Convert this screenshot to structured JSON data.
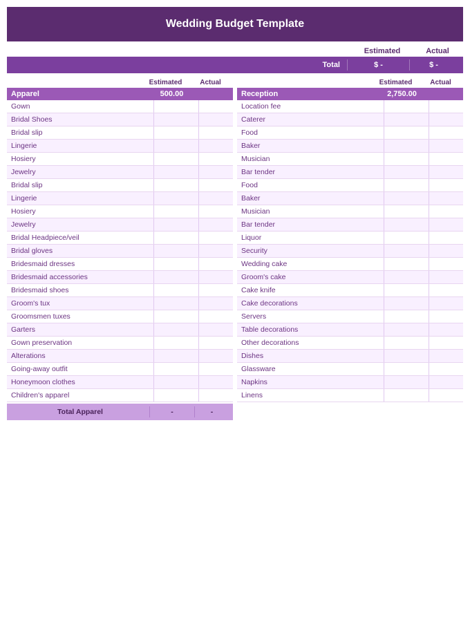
{
  "header": {
    "title": "Wedding Budget Template"
  },
  "summary": {
    "estimated_label": "Estimated",
    "actual_label": "Actual",
    "total_label": "Total",
    "estimated_value": "$ -",
    "actual_value": "$ -"
  },
  "left_column": {
    "col_estimated": "Estimated",
    "col_actual": "Actual",
    "category": "Apparel",
    "category_estimated": "500.00",
    "items": [
      "Gown",
      "Bridal Shoes",
      "Bridal slip",
      "Lingerie",
      "Hosiery",
      "Jewelry",
      "Bridal slip",
      "Lingerie",
      "Hosiery",
      "Jewelry",
      "Bridal Headpiece/veil",
      "Bridal gloves",
      "Bridesmaid dresses",
      "Bridesmaid accessories",
      "Bridesmaid shoes",
      "Groom's tux",
      "Groomsmen tuxes",
      "Garters",
      "Gown preservation",
      "Alterations",
      "Going-away outfit",
      "Honeymoon clothes",
      "Children's apparel"
    ],
    "total_label": "Total Apparel",
    "total_est": "-",
    "total_act": "-"
  },
  "right_column": {
    "col_estimated": "Estimated",
    "col_actual": "Actual",
    "category": "Reception",
    "category_estimated": "2,750.00",
    "items": [
      "Location fee",
      "Caterer",
      "Food",
      "Baker",
      "Musician",
      "Bar tender",
      "Food",
      "Baker",
      "Musician",
      "Bar tender",
      "Liquor",
      "Security",
      "Wedding cake",
      "Groom's cake",
      "Cake knife",
      "Cake decorations",
      "Servers",
      "Table decorations",
      "Other decorations",
      "Dishes",
      "Glassware",
      "Napkins",
      "Linens"
    ]
  },
  "colors": {
    "header_bg": "#5b2c6f",
    "category_bg": "#9b59b6",
    "total_bg": "#c9a0e0",
    "row_alt": "#f9f0ff"
  }
}
